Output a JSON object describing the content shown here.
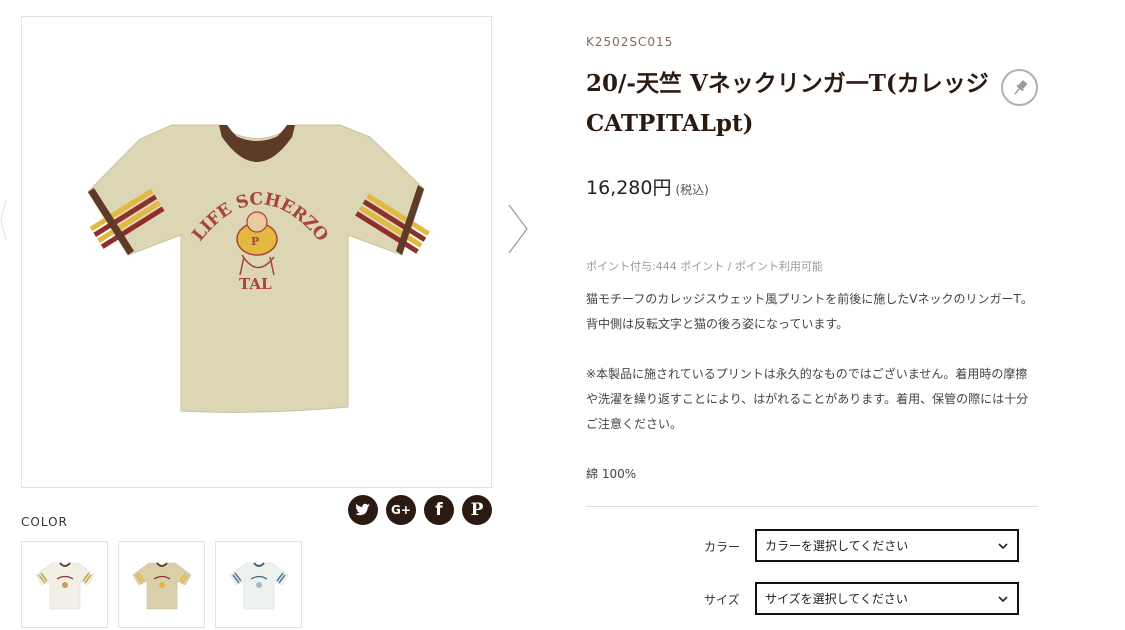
{
  "product": {
    "sku": "K2502SC015",
    "title": "20/-天竺 Vネックリンガ一T(カレッジCATPITALpt)",
    "price": "16,280円",
    "tax_note": "(税込)",
    "points": "ポイント付与:444 ポイント / ポイント利用可能",
    "description": [
      "猫モチーフのカレッジスウェット風プリントを前後に施したVネックのリンガーT。背中側は反転文字と猫の後ろ姿になっています。",
      "※本製品に施されているプリントは永久的なものではございません。着用時の摩擦や洗濯を繰り返すことにより、はがれることがあります。着用、保管の際には十分ご注意ください。"
    ],
    "material": "綿 100%"
  },
  "image": {
    "print_line1": "LIFE SCHERZO",
    "print_line2": "TAL"
  },
  "gallery": {
    "color_label": "COLOR",
    "swatches": [
      {
        "body": "#f2efe6",
        "trim": "#6a3b2a",
        "stripe1": "#c9a24a",
        "stripe2": "#8e2f2a"
      },
      {
        "body": "#d9cfa9",
        "trim": "#5e3a28",
        "stripe1": "#e2b840",
        "stripe2": "#8e2f2a"
      },
      {
        "body": "#eef2ee",
        "trim": "#3c6487",
        "stripe1": "#4f7da0",
        "stripe2": "#9dbad0"
      }
    ]
  },
  "social": [
    "twitter-icon",
    "google-plus-icon",
    "facebook-icon",
    "pinterest-icon"
  ],
  "options": {
    "color_label": "カラー",
    "color_placeholder": "カラーを選択してください",
    "size_label": "サイズ",
    "size_placeholder": "サイズを選択してください"
  },
  "colors": {
    "title": "#2b1a12",
    "shirt_body": "#ddd6b4",
    "shirt_trim": "#5e3a28",
    "stripe_yellow": "#e2b840",
    "stripe_red": "#8e2f2a",
    "print_red": "#a8433a"
  }
}
